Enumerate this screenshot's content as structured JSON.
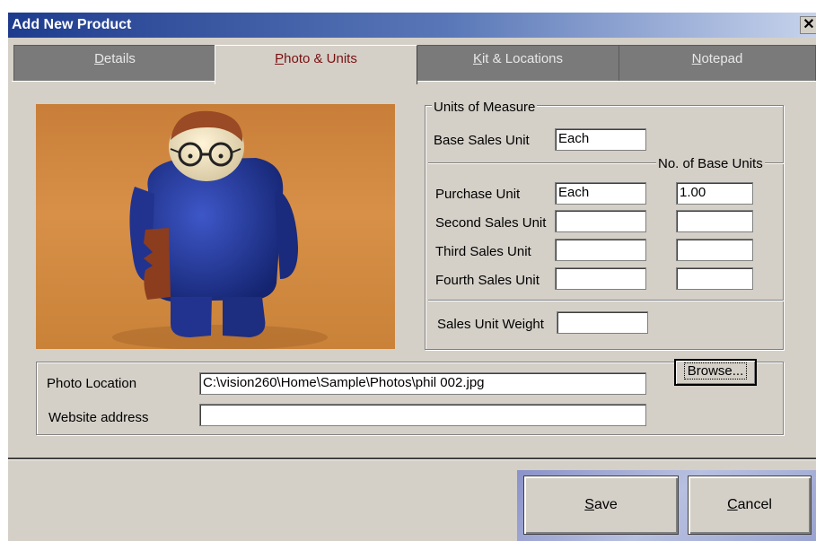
{
  "window": {
    "title": "Add New Product",
    "close_glyph": "✕"
  },
  "tabs": [
    {
      "label_first": "D",
      "label_rest": "etails",
      "active": false
    },
    {
      "label_first": "P",
      "label_rest": "hoto & Units",
      "active": true
    },
    {
      "label_first": "K",
      "label_rest": "it & Locations",
      "active": false
    },
    {
      "label_first": "N",
      "label_rest": "otepad",
      "active": false
    }
  ],
  "units": {
    "legend": "Units of Measure",
    "base_sales_unit_label": "Base Sales Unit",
    "base_sales_unit_value": "Each",
    "base_units_legend": "No. of Base Units",
    "purchase_unit_label": "Purchase Unit",
    "purchase_unit_value": "Each",
    "purchase_base_units": "1.00",
    "second_sales_unit_label": "Second Sales Unit",
    "second_sales_unit_value": "",
    "second_base_units": "",
    "third_sales_unit_label": "Third Sales Unit",
    "third_sales_unit_value": "",
    "third_base_units": "",
    "fourth_sales_unit_label": "Fourth Sales Unit",
    "fourth_sales_unit_value": "",
    "fourth_base_units": "",
    "sales_unit_weight_label": "Sales Unit Weight",
    "sales_unit_weight_value": ""
  },
  "photo": {
    "location_label": "Photo Location",
    "location_value": "C:\\vision260\\Home\\Sample\\Photos\\phil 002.jpg",
    "website_label": "Website address",
    "website_value": "",
    "browse_label": "Browse..."
  },
  "actions": {
    "save_first": "S",
    "save_rest": "ave",
    "cancel_first": "C",
    "cancel_rest": "ancel"
  },
  "colors": {
    "title_bar": "#1e3c8e",
    "active_tab_text": "#7a1010",
    "inactive_tab": "#7a7a7a",
    "dialog_face": "#d4d0c8"
  }
}
